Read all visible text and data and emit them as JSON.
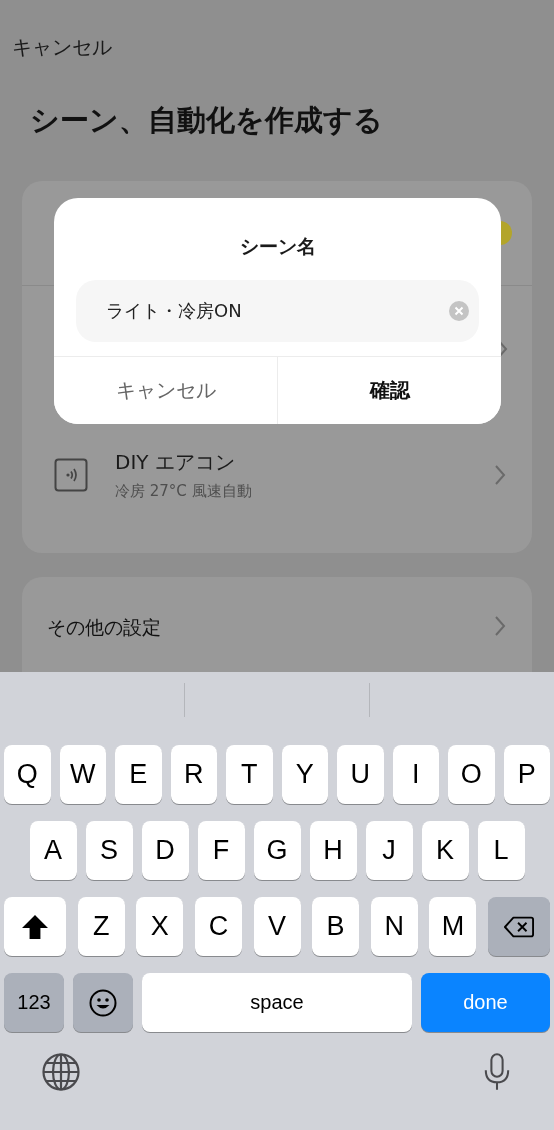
{
  "nav": {
    "cancel": "キャンセル"
  },
  "title": "シーン、自動化を作成する",
  "card": {
    "rows": [
      {
        "name": "DIY エアコン",
        "detail": "冷房 27°C 風速自動"
      }
    ]
  },
  "settings": {
    "label": "その他の設定"
  },
  "dialog": {
    "title": "シーン名",
    "field": {
      "value": "ライト・冷房ON"
    },
    "buttons": [
      {
        "label": "キャンセル",
        "kind": "cancel"
      },
      {
        "label": "確認",
        "kind": "confirm"
      }
    ]
  },
  "keyboard": {
    "rows": [
      {
        "keys": [
          {
            "kind": "letter",
            "label": "Q"
          },
          {
            "kind": "letter",
            "label": "W"
          },
          {
            "kind": "letter",
            "label": "E"
          },
          {
            "kind": "letter",
            "label": "R"
          },
          {
            "kind": "letter",
            "label": "T"
          },
          {
            "kind": "letter",
            "label": "Y"
          },
          {
            "kind": "letter",
            "label": "U"
          },
          {
            "kind": "letter",
            "label": "I"
          },
          {
            "kind": "letter",
            "label": "O"
          },
          {
            "kind": "letter",
            "label": "P"
          }
        ]
      },
      {
        "keys": [
          {
            "kind": "letter",
            "label": "A"
          },
          {
            "kind": "letter",
            "label": "S"
          },
          {
            "kind": "letter",
            "label": "D"
          },
          {
            "kind": "letter",
            "label": "F"
          },
          {
            "kind": "letter",
            "label": "G"
          },
          {
            "kind": "letter",
            "label": "H"
          },
          {
            "kind": "letter",
            "label": "J"
          },
          {
            "kind": "letter",
            "label": "K"
          },
          {
            "kind": "letter",
            "label": "L"
          }
        ]
      },
      {
        "keys": [
          {
            "kind": "shift",
            "on": true
          },
          {
            "kind": "letter",
            "label": "Z"
          },
          {
            "kind": "letter",
            "label": "X"
          },
          {
            "kind": "letter",
            "label": "C"
          },
          {
            "kind": "letter",
            "label": "V"
          },
          {
            "kind": "letter",
            "label": "B"
          },
          {
            "kind": "letter",
            "label": "N"
          },
          {
            "kind": "letter",
            "label": "M"
          },
          {
            "kind": "delete"
          }
        ]
      },
      {
        "keys": [
          {
            "kind": "numbers",
            "label": "123"
          },
          {
            "kind": "emoji"
          },
          {
            "kind": "space",
            "label": "space"
          },
          {
            "kind": "done",
            "label": "done"
          }
        ]
      }
    ]
  }
}
